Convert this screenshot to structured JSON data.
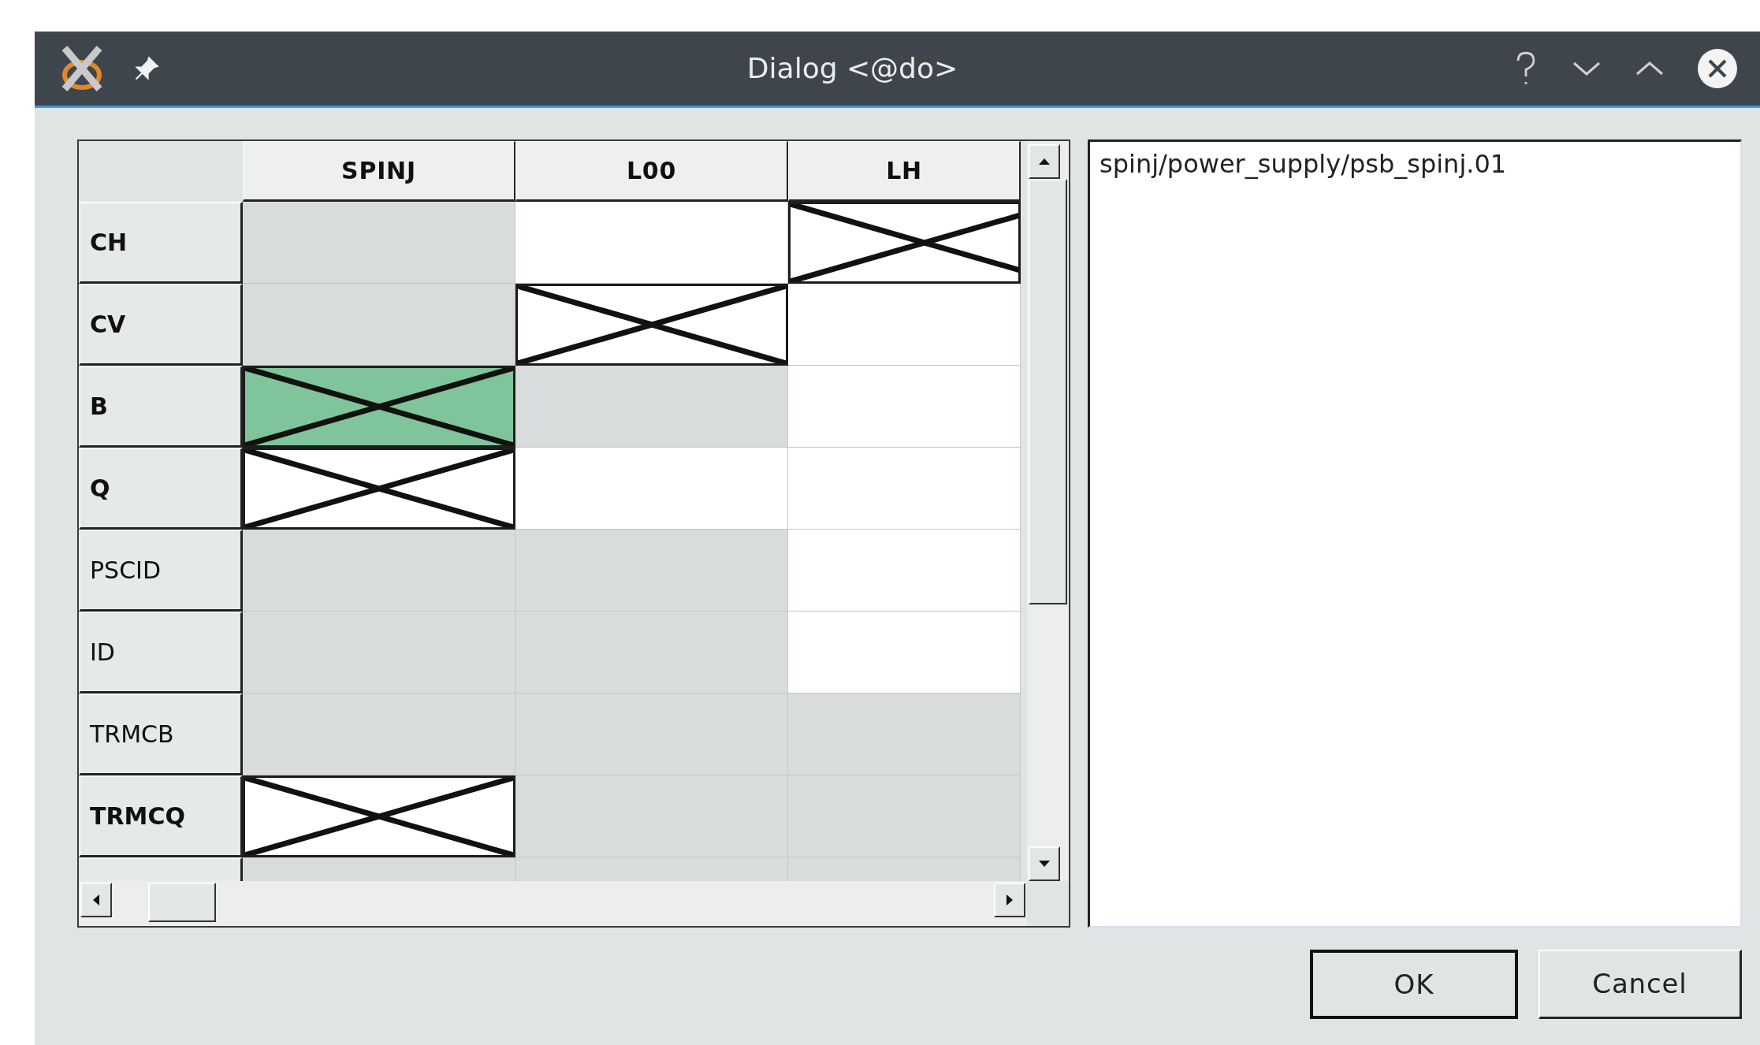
{
  "window": {
    "title": "Dialog <@do>"
  },
  "table": {
    "columns": [
      "SPINJ",
      "L00",
      "LH"
    ],
    "rows": [
      {
        "label": "CH",
        "bold": true,
        "cells": [
          {
            "enabled": false,
            "crossed": false,
            "selected": false
          },
          {
            "enabled": true,
            "crossed": false,
            "selected": false
          },
          {
            "enabled": true,
            "crossed": true,
            "selected": false
          }
        ]
      },
      {
        "label": "CV",
        "bold": true,
        "cells": [
          {
            "enabled": false,
            "crossed": false,
            "selected": false
          },
          {
            "enabled": true,
            "crossed": true,
            "selected": false
          },
          {
            "enabled": true,
            "crossed": false,
            "selected": false
          }
        ]
      },
      {
        "label": "B",
        "bold": true,
        "cells": [
          {
            "crossed": true,
            "selected": true
          },
          {
            "enabled": false,
            "crossed": false,
            "selected": false
          },
          {
            "enabled": true,
            "crossed": false,
            "selected": false
          }
        ]
      },
      {
        "label": "Q",
        "bold": true,
        "cells": [
          {
            "enabled": true,
            "crossed": true,
            "selected": false
          },
          {
            "enabled": true,
            "crossed": false,
            "selected": false
          },
          {
            "enabled": true,
            "crossed": false,
            "selected": false
          }
        ]
      },
      {
        "label": "PSCID",
        "bold": false,
        "cells": [
          {
            "enabled": false,
            "crossed": false,
            "selected": false
          },
          {
            "enabled": false,
            "crossed": false,
            "selected": false
          },
          {
            "enabled": true,
            "crossed": false,
            "selected": false
          }
        ]
      },
      {
        "label": "ID",
        "bold": false,
        "cells": [
          {
            "enabled": false,
            "crossed": false,
            "selected": false
          },
          {
            "enabled": false,
            "crossed": false,
            "selected": false
          },
          {
            "enabled": true,
            "crossed": false,
            "selected": false
          }
        ]
      },
      {
        "label": "TRMCB",
        "bold": false,
        "cells": [
          {
            "enabled": false,
            "crossed": false,
            "selected": false
          },
          {
            "enabled": false,
            "crossed": false,
            "selected": false
          },
          {
            "enabled": false,
            "crossed": false,
            "selected": false
          }
        ]
      },
      {
        "label": "TRMCQ",
        "bold": true,
        "cells": [
          {
            "enabled": true,
            "crossed": true,
            "selected": false
          },
          {
            "enabled": false,
            "crossed": false,
            "selected": false
          },
          {
            "enabled": false,
            "crossed": false,
            "selected": false
          }
        ]
      },
      {
        "cells": [
          {
            "enabled": false,
            "crossed": false,
            "selected": false
          },
          {
            "enabled": false,
            "crossed": false,
            "selected": false
          },
          {
            "enabled": false,
            "crossed": false,
            "selected": false
          }
        ]
      }
    ]
  },
  "list": {
    "items": [
      "spinj/power_supply/psb_spinj.01"
    ]
  },
  "buttons": [
    {
      "label": "OK",
      "default": true
    },
    {
      "label": "Cancel",
      "default": false
    }
  ]
}
